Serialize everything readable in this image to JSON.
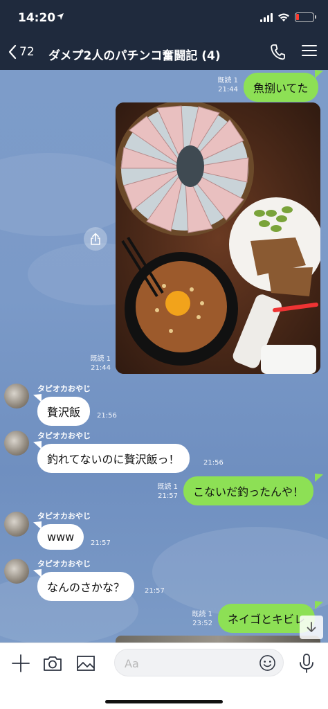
{
  "status": {
    "time": "14:20"
  },
  "header": {
    "back_count": "72",
    "title": "ダメプ2人のパチンコ奮闘記 (4)"
  },
  "messages": {
    "m1": {
      "text": "魚捌いてた",
      "read": "既読 1",
      "time": "21:44"
    },
    "m2": {
      "read": "既読 1",
      "time": "21:44"
    },
    "m3": {
      "sender": "タピオカおやじ",
      "text": "贅沢飯",
      "time": "21:56"
    },
    "m4": {
      "sender": "タピオカおやじ",
      "text": "釣れてないのに贅沢飯っ！",
      "time": "21:56"
    },
    "m5": {
      "text": "こないだ釣ったんや！",
      "read": "既読 1",
      "time": "21:57"
    },
    "m6": {
      "sender": "タピオカおやじ",
      "text": "www",
      "time": "21:57"
    },
    "m7": {
      "sender": "タピオカおやじ",
      "text": "なんのさかな？",
      "time": "21:57"
    },
    "m8": {
      "text": "ネイゴとキビレ",
      "read": "既読 1",
      "time": "23:52"
    }
  },
  "input": {
    "placeholder": "Aa"
  },
  "colors": {
    "header": "#1f2a3d",
    "chat_bg": "#7b9ac8",
    "bubble_out": "#8de055",
    "bubble_in": "#ffffff"
  }
}
